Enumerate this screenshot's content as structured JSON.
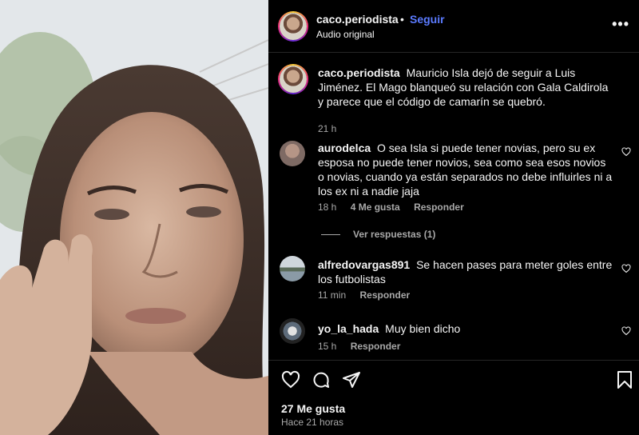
{
  "post": {
    "author": "caco.periodista",
    "separator": "•",
    "follow_label": "Seguir",
    "audio": "Audio original",
    "more_label": "•••"
  },
  "caption": {
    "username": "caco.periodista",
    "text": "Mauricio Isla dejó de seguir a Luis Jiménez. El Mago blanqueó su relación con Gala Caldirola y parece que el código de camarín se quebró.",
    "time": "21 h"
  },
  "comments": [
    {
      "username": "aurodelca",
      "text": "O sea Isla si puede tener novias, pero su ex esposa no puede tener novios, sea como sea esos novios o novias, cuando ya están separados no debe influirles ni a los ex ni a nadie jaja",
      "time": "18 h",
      "likes": "4 Me gusta",
      "reply": "Responder",
      "view_replies": "Ver respuestas (1)"
    },
    {
      "username": "alfredovargas891",
      "text": "Se hacen pases para meter goles entre los futbolistas",
      "time": "11 min",
      "reply": "Responder"
    },
    {
      "username": "yo_la_hada",
      "text": "Muy bien dicho",
      "time": "15 h",
      "reply": "Responder"
    }
  ],
  "footer": {
    "likes": "27 Me gusta",
    "time": "Hace 21 horas"
  }
}
